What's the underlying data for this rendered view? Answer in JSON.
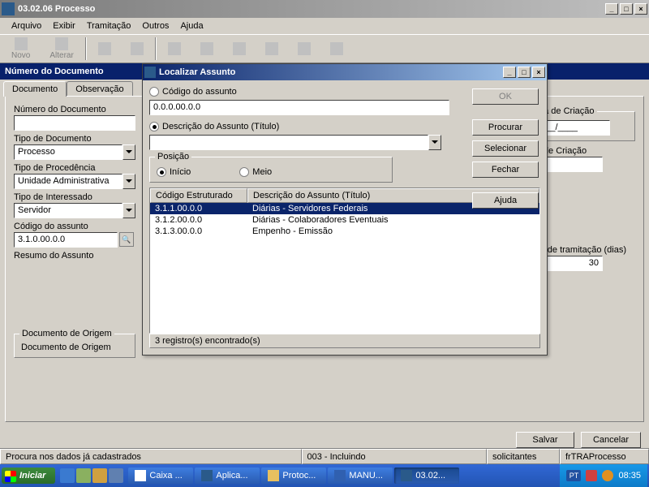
{
  "window": {
    "title": "03.02.06 Processo",
    "min": "_",
    "max": "□",
    "close": "×"
  },
  "menu": {
    "arquivo": "Arquivo",
    "exibir": "Exibir",
    "tramitacao": "Tramitação",
    "outros": "Outros",
    "ajuda": "Ajuda"
  },
  "toolbar": {
    "novo": "Novo",
    "alterar": "Alterar"
  },
  "bluebar": "Número do Documento",
  "tabs": {
    "documento": "Documento",
    "observacao": "Observação"
  },
  "form": {
    "numDocLabel": "Número do Documento",
    "tipoDocLabel": "Tipo de Documento",
    "tipoDocValue": "Processo",
    "tipoProcLabel": "Tipo de Procedência",
    "tipoProcValue": "Unidade Administrativa",
    "tipoIntLabel": "Tipo de Interessado",
    "tipoIntValue": "Servidor",
    "codAssuntoLabel": "Código do assunto",
    "codAssuntoValue": "3.1.0.00.0.0",
    "resumoLabel": "Resumo do Assunto",
    "docOrigemGroup": "Documento de Origem",
    "docOrigemLabel": "Documento de Origem",
    "dataCriacaoLabel": "Data de Criação",
    "dataCriacaoValue": "__/__/____",
    "horaCriacaoLabel": "Hora de Criação",
    "prazoLabel": "Prazo de tramitação (dias)",
    "prazoValue": "30"
  },
  "buttons": {
    "salvar": "Salvar",
    "cancelar": "Cancelar"
  },
  "status": {
    "s1": "Procura nos dados já cadastrados",
    "s2": "003 - Incluindo",
    "s3": "solicitantes",
    "s4": "frTRAProcesso"
  },
  "taskbar": {
    "start": "Iniciar",
    "tasks": [
      "Caixa ...",
      "Aplica...",
      "Protoc...",
      "MANU...",
      "03.02..."
    ],
    "lang": "PT",
    "clock": "08:35"
  },
  "dialog": {
    "title": "Localizar Assunto",
    "radioCodigo": "Código do assunto",
    "codigoValue": "0.0.0.00.0.0",
    "radioDesc": "Descrição do Assunto (Título)",
    "posicaoGroup": "Posição",
    "radioInicio": "Início",
    "radioMeio": "Meio",
    "btnOk": "OK",
    "btnProcurar": "Procurar",
    "btnSelecionar": "Selecionar",
    "btnFechar": "Fechar",
    "btnAjuda": "Ajuda",
    "col1": "Código Estruturado",
    "col2": "Descrição do Assunto (Título)",
    "rows": [
      {
        "c": "3.1.1.00.0.0",
        "d": "Diárias - Servidores Federais"
      },
      {
        "c": "3.1.2.00.0.0",
        "d": "Diárias - Colaboradores Eventuais"
      },
      {
        "c": "3.1.3.00.0.0",
        "d": "Empenho - Emissão"
      }
    ],
    "statusText": "3 registro(s) encontrado(s)"
  }
}
